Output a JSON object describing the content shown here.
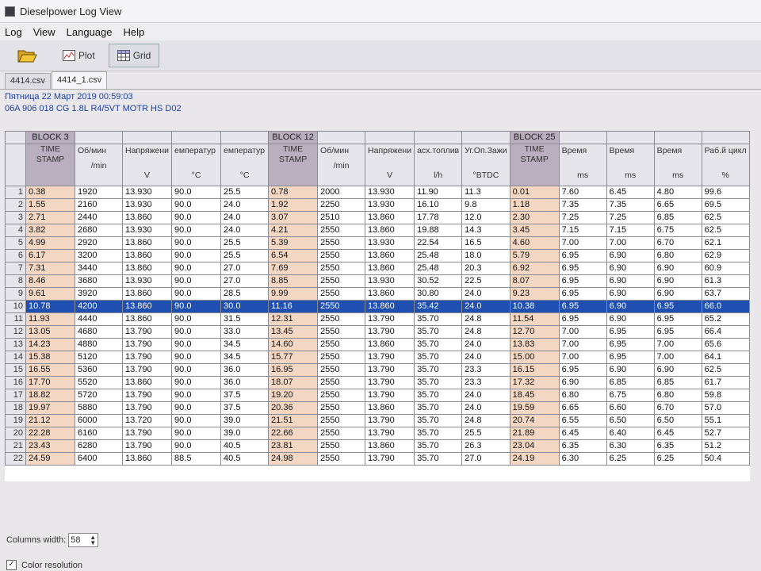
{
  "window": {
    "title": "Dieselpower Log View"
  },
  "menu": [
    "Log",
    "View",
    "Language",
    "Help"
  ],
  "toolbar": {
    "open_icon": "folder-open-icon",
    "plot_label": "Plot",
    "grid_label": "Grid"
  },
  "tabs": [
    "4414.csv",
    "4414_1.csv"
  ],
  "info": {
    "date": "Пятница 22 Март 2019 00:59:03",
    "ecu": "06A 906 018 CG  1.8L R4/5VT MOTR HS D02"
  },
  "blocks": [
    "BLOCK 3",
    "BLOCK 12",
    "BLOCK 25"
  ],
  "columns": [
    {
      "name": "TIME STAMP",
      "unit": ""
    },
    {
      "name": "Об/мин",
      "unit": "/min"
    },
    {
      "name": "Напряжени",
      "unit": "V"
    },
    {
      "name": "емператур",
      "unit": "°C"
    },
    {
      "name": "емператур",
      "unit": "°C"
    },
    {
      "name": "TIME STAMP",
      "unit": ""
    },
    {
      "name": "Об/мин",
      "unit": "/min"
    },
    {
      "name": "Напряжени",
      "unit": "V"
    },
    {
      "name": "асх.топлив",
      "unit": "l/h"
    },
    {
      "name": "Уг.Оп.Зажи",
      "unit": "°BTDC"
    },
    {
      "name": "TIME STAMP",
      "unit": ""
    },
    {
      "name": "Время",
      "unit": "ms"
    },
    {
      "name": "Время",
      "unit": "ms"
    },
    {
      "name": "Время",
      "unit": "ms"
    },
    {
      "name": "Раб.й цикл",
      "unit": "%"
    }
  ],
  "selected_row": 10,
  "rows": [
    [
      "0.38",
      "1920",
      "13.930",
      "90.0",
      "25.5",
      "0.78",
      "2000",
      "13.930",
      "11.90",
      "11.3",
      "0.01",
      "7.60",
      "6.45",
      "4.80",
      "99.6"
    ],
    [
      "1.55",
      "2160",
      "13.930",
      "90.0",
      "24.0",
      "1.92",
      "2250",
      "13.930",
      "16.10",
      "9.8",
      "1.18",
      "7.35",
      "7.35",
      "6.65",
      "69.5"
    ],
    [
      "2.71",
      "2440",
      "13.860",
      "90.0",
      "24.0",
      "3.07",
      "2510",
      "13.860",
      "17.78",
      "12.0",
      "2.30",
      "7.25",
      "7.25",
      "6.85",
      "62.5"
    ],
    [
      "3.82",
      "2680",
      "13.930",
      "90.0",
      "24.0",
      "4.21",
      "2550",
      "13.860",
      "19.88",
      "14.3",
      "3.45",
      "7.15",
      "7.15",
      "6.75",
      "62.5"
    ],
    [
      "4.99",
      "2920",
      "13.860",
      "90.0",
      "25.5",
      "5.39",
      "2550",
      "13.930",
      "22.54",
      "16.5",
      "4.60",
      "7.00",
      "7.00",
      "6.70",
      "62.1"
    ],
    [
      "6.17",
      "3200",
      "13.860",
      "90.0",
      "25.5",
      "6.54",
      "2550",
      "13.860",
      "25.48",
      "18.0",
      "5.79",
      "6.95",
      "6.90",
      "6.80",
      "62.9"
    ],
    [
      "7.31",
      "3440",
      "13.860",
      "90.0",
      "27.0",
      "7.69",
      "2550",
      "13.860",
      "25.48",
      "20.3",
      "6.92",
      "6.95",
      "6.90",
      "6.90",
      "60.9"
    ],
    [
      "8.46",
      "3680",
      "13.930",
      "90.0",
      "27.0",
      "8.85",
      "2550",
      "13.930",
      "30.52",
      "22.5",
      "8.07",
      "6.95",
      "6.90",
      "6.90",
      "61.3"
    ],
    [
      "9.61",
      "3920",
      "13.860",
      "90.0",
      "28.5",
      "9.99",
      "2550",
      "13.860",
      "30.80",
      "24.0",
      "9.23",
      "6.95",
      "6.90",
      "6.90",
      "63.7"
    ],
    [
      "10.78",
      "4200",
      "13.860",
      "90.0",
      "30.0",
      "11.16",
      "2550",
      "13.860",
      "35.42",
      "24.0",
      "10.38",
      "6.95",
      "6.90",
      "6.95",
      "66.0"
    ],
    [
      "11.93",
      "4440",
      "13.860",
      "90.0",
      "31.5",
      "12.31",
      "2550",
      "13.790",
      "35.70",
      "24.8",
      "11.54",
      "6.95",
      "6.90",
      "6.95",
      "65.2"
    ],
    [
      "13.05",
      "4680",
      "13.790",
      "90.0",
      "33.0",
      "13.45",
      "2550",
      "13.790",
      "35.70",
      "24.8",
      "12.70",
      "7.00",
      "6.95",
      "6.95",
      "66.4"
    ],
    [
      "14.23",
      "4880",
      "13.790",
      "90.0",
      "34.5",
      "14.60",
      "2550",
      "13.860",
      "35.70",
      "24.0",
      "13.83",
      "7.00",
      "6.95",
      "7.00",
      "65.6"
    ],
    [
      "15.38",
      "5120",
      "13.790",
      "90.0",
      "34.5",
      "15.77",
      "2550",
      "13.790",
      "35.70",
      "24.0",
      "15.00",
      "7.00",
      "6.95",
      "7.00",
      "64.1"
    ],
    [
      "16.55",
      "5360",
      "13.790",
      "90.0",
      "36.0",
      "16.95",
      "2550",
      "13.790",
      "35.70",
      "23.3",
      "16.15",
      "6.95",
      "6.90",
      "6.90",
      "62.5"
    ],
    [
      "17.70",
      "5520",
      "13.860",
      "90.0",
      "36.0",
      "18.07",
      "2550",
      "13.790",
      "35.70",
      "23.3",
      "17.32",
      "6.90",
      "6.85",
      "6.85",
      "61.7"
    ],
    [
      "18.82",
      "5720",
      "13.790",
      "90.0",
      "37.5",
      "19.20",
      "2550",
      "13.790",
      "35.70",
      "24.0",
      "18.45",
      "6.80",
      "6.75",
      "6.80",
      "59.8"
    ],
    [
      "19.97",
      "5880",
      "13.790",
      "90.0",
      "37.5",
      "20.36",
      "2550",
      "13.860",
      "35.70",
      "24.0",
      "19.59",
      "6.65",
      "6.60",
      "6.70",
      "57.0"
    ],
    [
      "21.12",
      "6000",
      "13.720",
      "90.0",
      "39.0",
      "21.51",
      "2550",
      "13.790",
      "35.70",
      "24.8",
      "20.74",
      "6.55",
      "6.50",
      "6.50",
      "55.1"
    ],
    [
      "22.28",
      "6160",
      "13.790",
      "90.0",
      "39.0",
      "22.66",
      "2550",
      "13.790",
      "35.70",
      "25.5",
      "21.89",
      "6.45",
      "6.40",
      "6.45",
      "52.7"
    ],
    [
      "23.43",
      "6280",
      "13.790",
      "90.0",
      "40.5",
      "23.81",
      "2550",
      "13.860",
      "35.70",
      "26.3",
      "23.04",
      "6.35",
      "6.30",
      "6.35",
      "51.2"
    ],
    [
      "24.59",
      "6400",
      "13.860",
      "88.5",
      "40.5",
      "24.98",
      "2550",
      "13.790",
      "35.70",
      "27.0",
      "24.19",
      "6.30",
      "6.25",
      "6.25",
      "50.4"
    ]
  ],
  "bottom": {
    "columns_width_label": "Columns width:",
    "columns_width_value": "58",
    "color_resolution_label": "Color resolution",
    "color_resolution_checked": true
  }
}
